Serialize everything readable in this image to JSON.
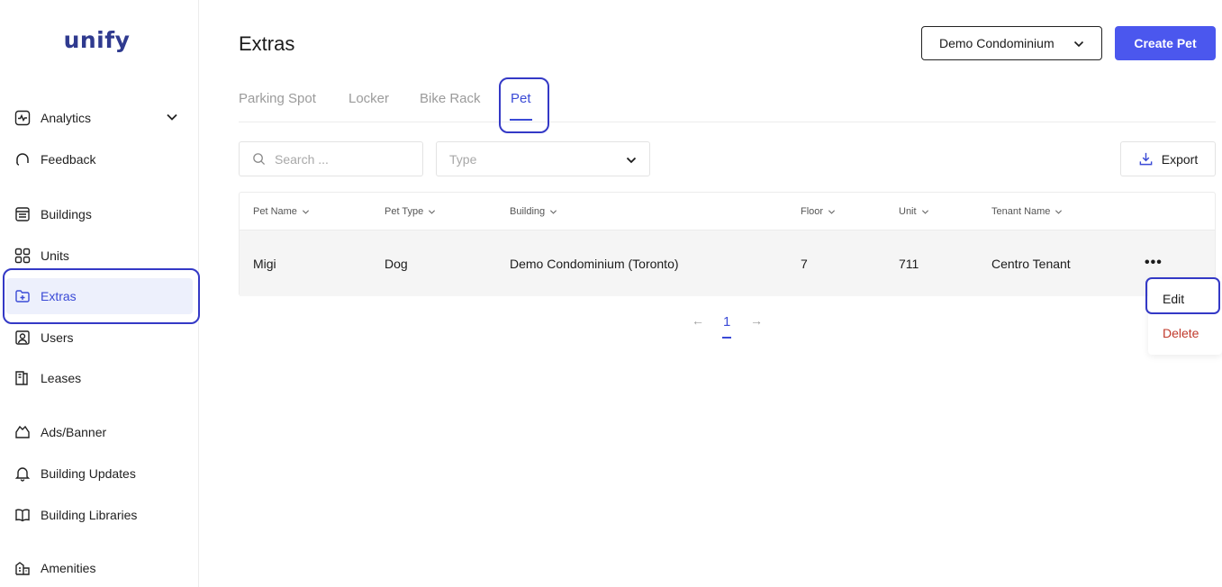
{
  "brand": {
    "logo_text": "unify"
  },
  "sidebar": {
    "items": [
      {
        "label": "Analytics",
        "icon": "analytics-icon",
        "has_chevron": true
      },
      {
        "label": "Feedback",
        "icon": "feedback-icon"
      },
      {
        "label": "Buildings",
        "icon": "buildings-icon"
      },
      {
        "label": "Units",
        "icon": "units-icon"
      },
      {
        "label": "Extras",
        "icon": "extras-icon",
        "active": true
      },
      {
        "label": "Users",
        "icon": "users-icon"
      },
      {
        "label": "Leases",
        "icon": "leases-icon"
      },
      {
        "label": "Ads/Banner",
        "icon": "ads-icon"
      },
      {
        "label": "Building Updates",
        "icon": "bell-icon"
      },
      {
        "label": "Building Libraries",
        "icon": "book-icon"
      },
      {
        "label": "Amenities",
        "icon": "amenities-icon"
      }
    ]
  },
  "header": {
    "title": "Extras",
    "building_select": "Demo Condominium",
    "create_button": "Create Pet"
  },
  "tabs": [
    {
      "label": "Parking Spot"
    },
    {
      "label": "Locker"
    },
    {
      "label": "Bike Rack"
    },
    {
      "label": "Pet",
      "active": true
    }
  ],
  "filters": {
    "search_placeholder": "Search ...",
    "type_placeholder": "Type",
    "export_label": "Export"
  },
  "table": {
    "columns": [
      "Pet Name",
      "Pet Type",
      "Building",
      "Floor",
      "Unit",
      "Tenant Name"
    ],
    "rows": [
      [
        "Migi",
        "Dog",
        "Demo Condominium (Toronto)",
        "7",
        "711",
        "Centro Tenant"
      ]
    ],
    "row_actions_label": "•••"
  },
  "pagination": {
    "current_page": "1",
    "prev": "←",
    "next": "→"
  },
  "row_menu": {
    "edit_label": "Edit",
    "delete_label": "Delete"
  },
  "colors": {
    "primary": "#4b57ee",
    "accent": "#3a4ad6",
    "highlight": "#3439c6",
    "danger": "#c0392b"
  }
}
